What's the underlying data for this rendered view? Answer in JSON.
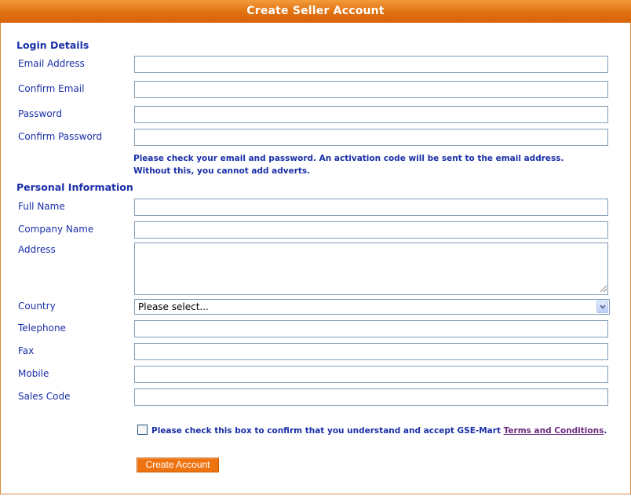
{
  "title": "Create Seller Account",
  "login": {
    "heading": "Login Details",
    "email_label": "Email Address",
    "confirm_email_label": "Confirm Email",
    "password_label": "Password",
    "confirm_password_label": "Confirm Password",
    "note_line1": "Please check your email and password. An activation code will be sent to the email address.",
    "note_line2": "Without this, you cannot add adverts."
  },
  "personal": {
    "heading": "Personal Information",
    "full_name_label": "Full Name",
    "company_label": "Company Name",
    "address_label": "Address",
    "country_label": "Country",
    "country_value": "Please select...",
    "telephone_label": "Telephone",
    "fax_label": "Fax",
    "mobile_label": "Mobile",
    "sales_code_label": "Sales Code"
  },
  "terms": {
    "text": "Please check this box to confirm that you understand and accept GSE-Mart ",
    "link": "Terms and Conditions",
    "end": "."
  },
  "submit_label": "Create Account",
  "colors": {
    "header_orange": "#e0700e",
    "label_blue": "#1a2fa8",
    "button_orange": "#ee7311",
    "link_purple": "#6b2a7d"
  }
}
